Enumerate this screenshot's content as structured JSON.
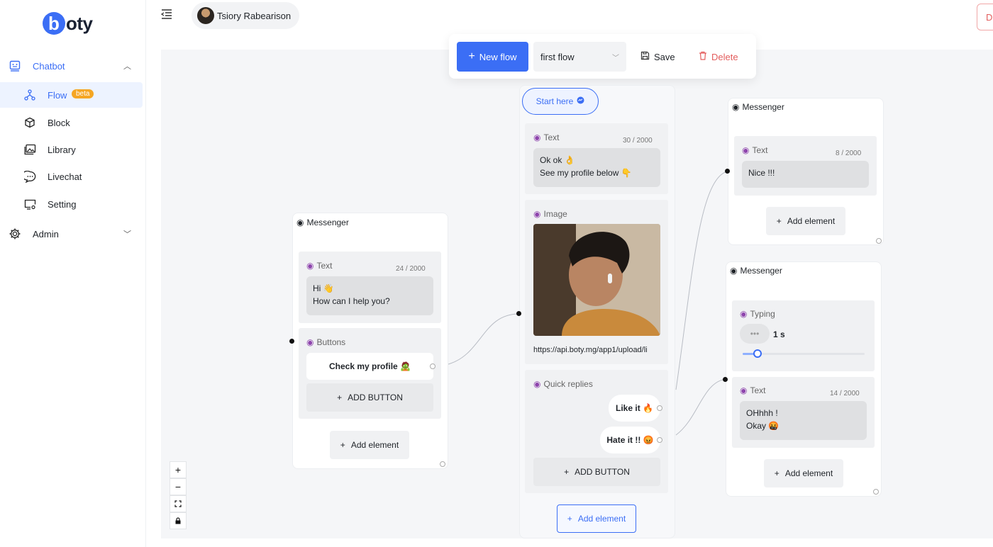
{
  "brand": {
    "logo_letter": "b",
    "logo_rest": "oty",
    "color": "#3b6ef5"
  },
  "sidebar": {
    "chatbot_label": "Chatbot",
    "items": [
      {
        "label": "Flow",
        "badge": "beta",
        "active": true
      },
      {
        "label": "Block"
      },
      {
        "label": "Library"
      },
      {
        "label": "Livechat"
      },
      {
        "label": "Setting"
      }
    ],
    "admin_label": "Admin"
  },
  "header": {
    "user_name": "Tsiory Rabearison",
    "right_button_label": "D"
  },
  "toolbar": {
    "new_flow_label": "New flow",
    "selected_flow": "first flow",
    "save_label": "Save",
    "delete_label": "Delete"
  },
  "nodes": {
    "start": {
      "label": "Start here"
    },
    "left": {
      "title": "Messenger",
      "text_label": "Text",
      "text_count": "24 / 2000",
      "text_body": "Hi 👋\nHow can I help you?",
      "buttons_label": "Buttons",
      "button_1": "Check my profile 🧟",
      "add_button_label": "ADD BUTTON",
      "add_element_label": "Add element"
    },
    "center": {
      "text_label": "Text",
      "text_count": "30 / 2000",
      "text_body": "Ok ok 👌\nSee my profile below 👇",
      "image_label": "Image",
      "image_url": "https://api.boty.mg/app1/upload/li",
      "quick_replies_label": "Quick replies",
      "reply_1": "Like it 🔥",
      "reply_2": "Hate it !! 😡",
      "add_button_label": "ADD BUTTON",
      "add_element_label": "Add element"
    },
    "right_top": {
      "title": "Messenger",
      "text_label": "Text",
      "text_count": "8 / 2000",
      "text_body": "Nice !!!",
      "add_element_label": "Add element"
    },
    "right_bottom": {
      "title": "Messenger",
      "typing_label": "Typing",
      "typing_value": "1 s",
      "typing_fraction": 0.12,
      "text_label": "Text",
      "text_count": "14 / 2000",
      "text_body": "OHhhh !\nOkay 🤬",
      "add_element_label": "Add element"
    }
  },
  "zoom_controls": {
    "zoom_in": "+",
    "zoom_out": "−"
  }
}
